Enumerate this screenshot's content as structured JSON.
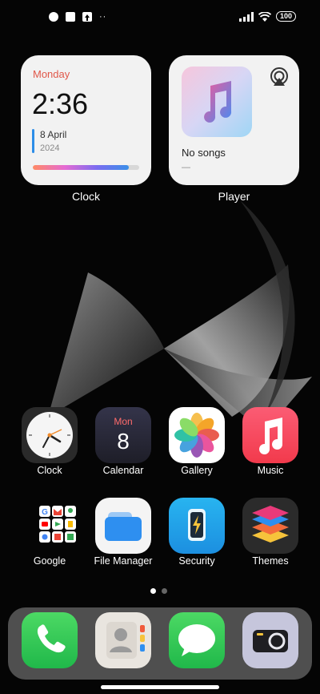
{
  "status_bar": {
    "more_indicator": "··",
    "battery": "100"
  },
  "widgets": {
    "clock": {
      "day": "Monday",
      "time": "2:36",
      "date": "8 April",
      "year": "2024",
      "progress": 0.9,
      "label": "Clock"
    },
    "player": {
      "title": "No songs",
      "subtitle": "—",
      "label": "Player"
    }
  },
  "apps": [
    {
      "label": "Clock",
      "icon": "clock-icon"
    },
    {
      "label": "Calendar",
      "icon": "calendar-icon",
      "month": "Mon",
      "day": "8"
    },
    {
      "label": "Gallery",
      "icon": "gallery-icon"
    },
    {
      "label": "Music",
      "icon": "music-icon"
    },
    {
      "label": "Google",
      "icon": "google-folder-icon"
    },
    {
      "label": "File Manager",
      "icon": "folder-icon"
    },
    {
      "label": "Security",
      "icon": "security-icon"
    },
    {
      "label": "Themes",
      "icon": "themes-icon"
    }
  ],
  "dock": [
    {
      "name": "Phone",
      "icon": "phone-icon"
    },
    {
      "name": "Contacts",
      "icon": "contacts-icon"
    },
    {
      "name": "Messages",
      "icon": "messages-icon"
    },
    {
      "name": "Camera",
      "icon": "camera-icon"
    }
  ],
  "pager": {
    "pages": 2,
    "current": 1
  }
}
